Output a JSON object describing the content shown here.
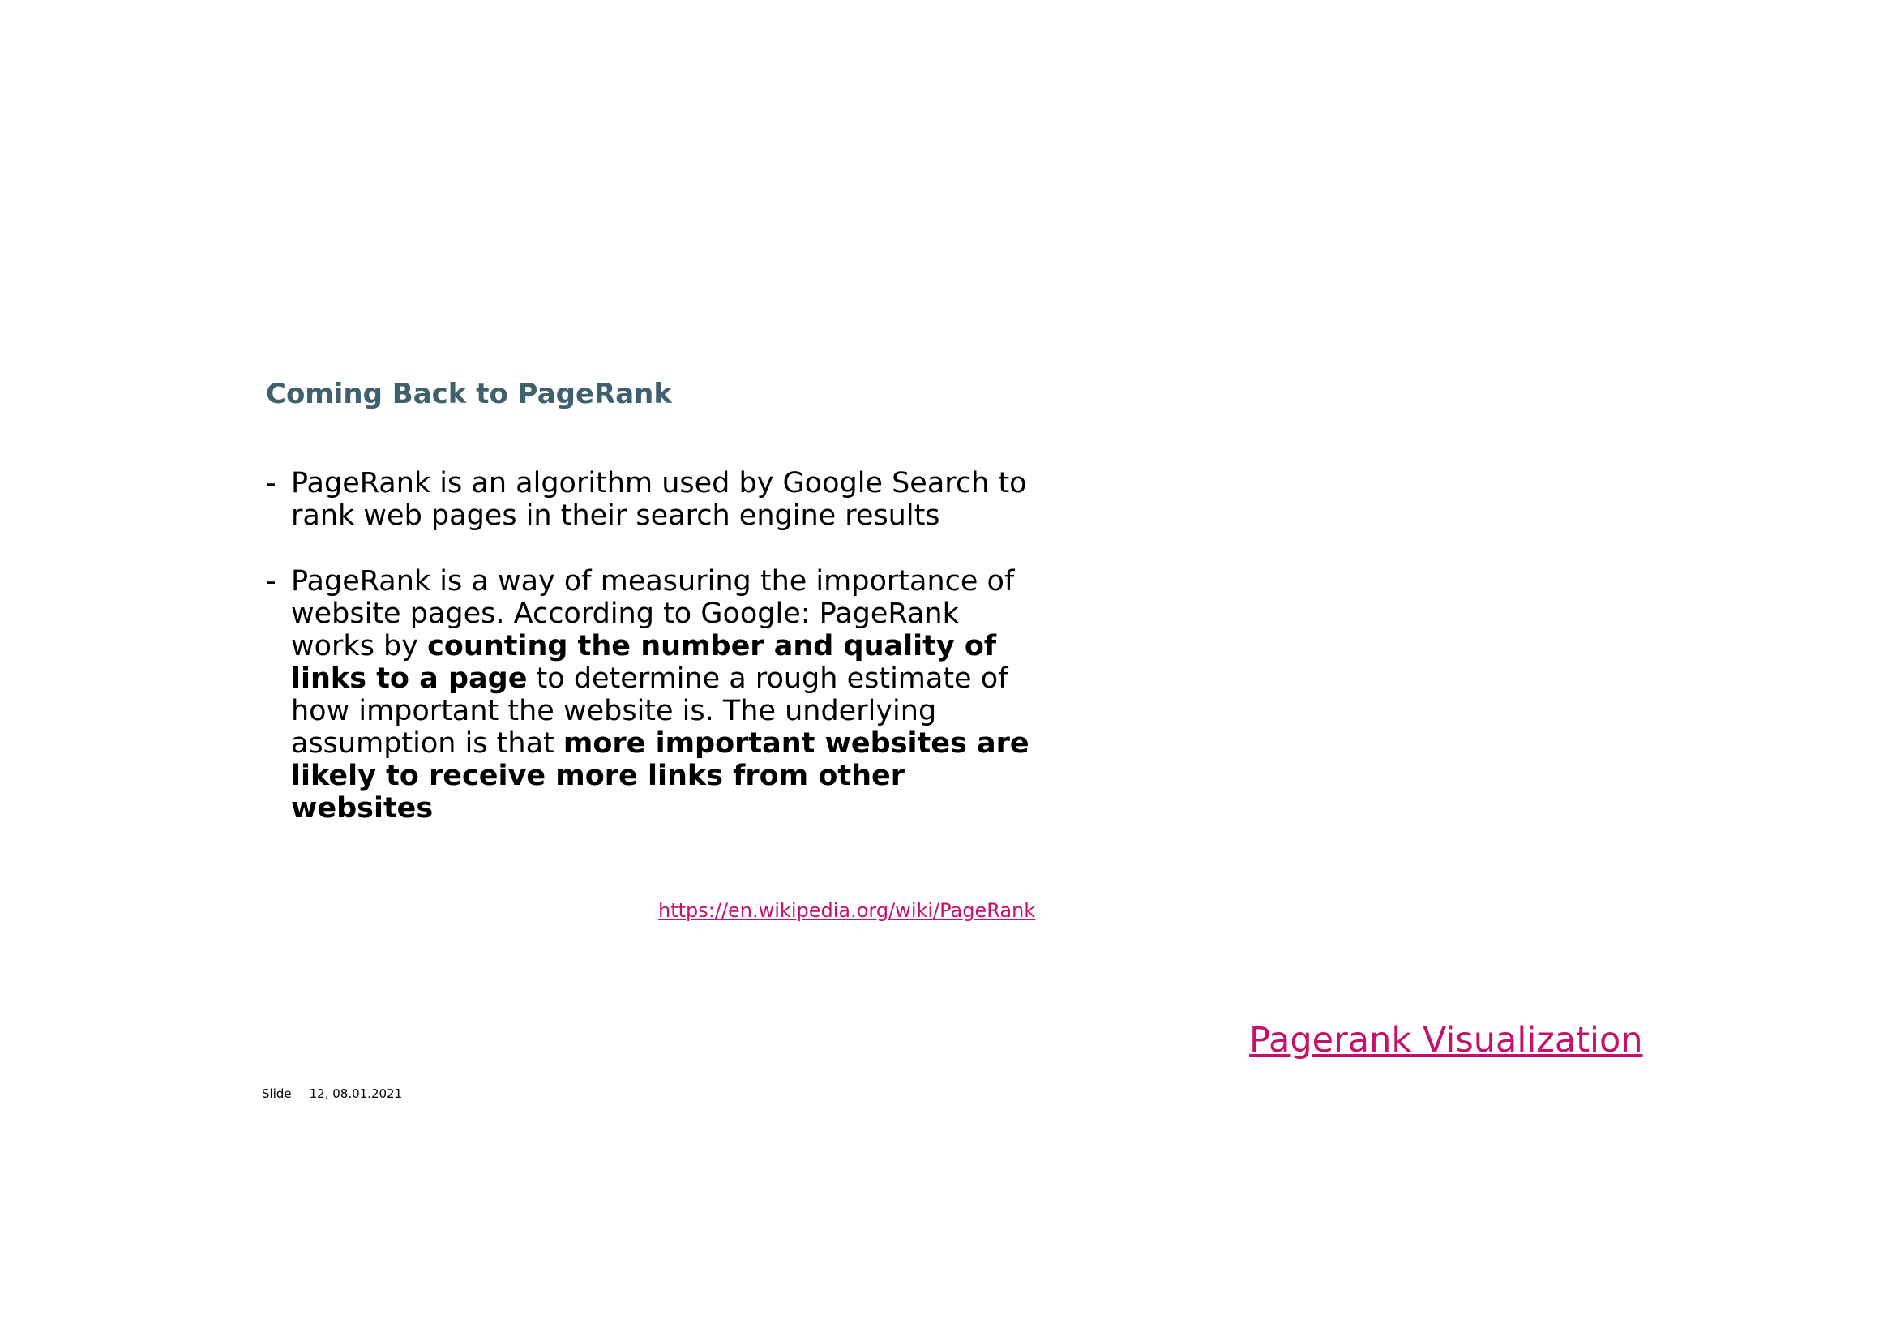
{
  "slide": {
    "title": "Coming Back to PageRank",
    "bullet_marker": "-",
    "bullets": [
      {
        "segments": [
          {
            "text": "PageRank is an algorithm used by Google Search to rank web pages in their search engine results",
            "bold": false
          }
        ]
      },
      {
        "segments": [
          {
            "text": "PageRank is a way of measuring the importance of website pages. According to Google: PageRank works by ",
            "bold": false
          },
          {
            "text": "counting the number and quality of links to a page",
            "bold": true
          },
          {
            "text": " to determine a rough estimate of how important the website is. The underlying assumption is that ",
            "bold": false
          },
          {
            "text": "more important websites are likely to receive more links from other websites",
            "bold": true
          }
        ]
      }
    ],
    "source_link": "https://en.wikipedia.org/wiki/PageRank",
    "visualization_link": "Pagerank Visualization",
    "footer": {
      "label": "Slide",
      "info": "12, 08.01.2021"
    }
  },
  "colors": {
    "title": "#41606e",
    "link": "#c8106b",
    "text": "#000000",
    "background": "#ffffff"
  }
}
